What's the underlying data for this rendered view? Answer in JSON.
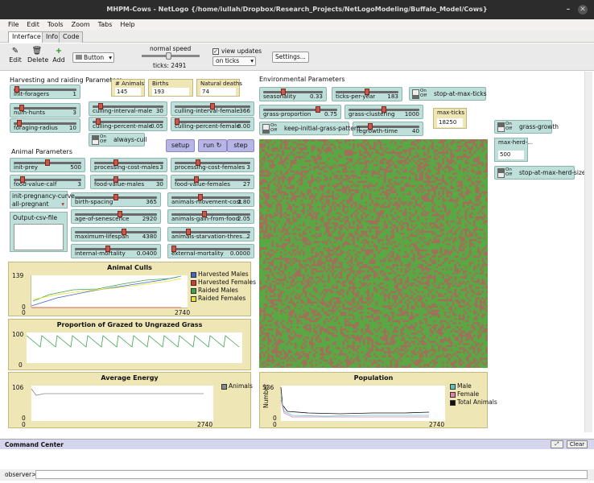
{
  "window": {
    "title": "MHPM-Cows - NetLogo {/home/iullah/Dropbox/Research_Projects/NetLogoModeling/Buffalo_Model/Cows}",
    "minimize": "–",
    "close": "✕"
  },
  "menu": [
    "File",
    "Edit",
    "Tools",
    "Zoom",
    "Tabs",
    "Help"
  ],
  "tabs": [
    "Interface",
    "Info",
    "Code"
  ],
  "toolbar": {
    "edit": "Edit",
    "delete": "Delete",
    "add": "Add",
    "widget_type": "Button",
    "speed_label": "normal speed",
    "ticks_label": "ticks: 2491",
    "view_updates": "view updates",
    "update_mode": "on ticks",
    "settings": "Settings..."
  },
  "headers": {
    "harvest": "Harvesting and raiding Parameters",
    "animal": "Animal Parameters",
    "env": "Environmental Parameters"
  },
  "monitors": {
    "animals_label": "# Animals",
    "animals": "145",
    "births_label": "Births",
    "births": "193",
    "natdeaths_label": "Natural deaths",
    "natdeaths": "74",
    "maxticks_label": "max-ticks",
    "maxticks": "18250",
    "maxherd_label": "max-herd-...",
    "maxherd": "500"
  },
  "sliders": {
    "init_foragers": {
      "label": "init-foragers",
      "value": "1",
      "level": 0.02
    },
    "num_hunts": {
      "label": "num-hunts",
      "value": "3",
      "level": 0.1
    },
    "foraging_radius": {
      "label": "foraging-radius",
      "value": "10",
      "level": 0.05
    },
    "culling_interval_male": {
      "label": "culling-interval-male",
      "value": "30",
      "level": 0.08
    },
    "culling_interval_female": {
      "label": "culling-interval-female",
      "value": "366",
      "level": 0.5
    },
    "culling_percent_male": {
      "label": "culling-percent-male",
      "value": "0.05",
      "level": 0.05
    },
    "culling_percent_female": {
      "label": "culling-percent-female",
      "value": "0.00",
      "level": 0.0
    },
    "init_prey": {
      "label": "init-prey",
      "value": "500",
      "level": 0.5
    },
    "processing_cost_males": {
      "label": "processing-cost-males",
      "value": "3",
      "level": 0.3
    },
    "processing_cost_females": {
      "label": "processing-cost-females",
      "value": "3",
      "level": 0.3
    },
    "food_value_calf": {
      "label": "food-value-calf",
      "value": "3",
      "level": 0.1
    },
    "food_value_males": {
      "label": "food-value-males",
      "value": "30",
      "level": 0.3
    },
    "food_value_females": {
      "label": "food-value-females",
      "value": "27",
      "level": 0.27
    },
    "birth_spacing": {
      "label": "birth-spacing",
      "value": "365",
      "level": 0.5
    },
    "animals_movement_cost": {
      "label": "animals-movement-cost",
      "value": "1.80",
      "level": 0.36
    },
    "age_of_senescence": {
      "label": "age-of-senescence",
      "value": "2920",
      "level": 0.55
    },
    "animals_gain_from_food": {
      "label": "animals-gain-from-food",
      "value": "2.05",
      "level": 0.41
    },
    "maximum_lifespan": {
      "label": "maximum-lifespan",
      "value": "4380",
      "level": 0.6
    },
    "animals_starvation_thres": {
      "label": "animals-starvation-thres...",
      "value": "2",
      "level": 0.2
    },
    "internal_mortality": {
      "label": "internal-mortality",
      "value": "0.0400",
      "level": 0.4
    },
    "external_mortality": {
      "label": "external-mortality",
      "value": "0.0000",
      "level": 0.0
    },
    "seasonality": {
      "label": "seasonality",
      "value": "0.33",
      "level": 0.33
    },
    "ticks_per_year": {
      "label": "ticks-per-year",
      "value": "183",
      "level": 0.5
    },
    "grass_proportion": {
      "label": "grass-proportion",
      "value": "0.75",
      "level": 0.75
    },
    "grass_clustering": {
      "label": "grass-clustering",
      "value": "1000",
      "level": 0.5
    },
    "regrowth_time": {
      "label": "regrowth-time",
      "value": "40",
      "level": 0.2
    }
  },
  "switches": {
    "always_cull": "always-cull",
    "stop_at_max_ticks": "stop-at-max-ticks",
    "keep_initial_grass": "keep-initial-grass-pattern",
    "grass_growth": "grass-growth",
    "stop_at_max_herd": "stop-at-max-herd-size",
    "on": "On",
    "off": "Off"
  },
  "buttons": {
    "setup": "setup",
    "run": "run",
    "step": "step"
  },
  "chooser": {
    "label": "init-pregnancy-curve",
    "value": "all-pregnant"
  },
  "input": {
    "label": "Output-csv-file",
    "value": ""
  },
  "plots": {
    "culls": {
      "title": "Animal Culls",
      "ymax": "139",
      "ymin": "0",
      "xmin": "0",
      "xmax": "2740",
      "legend": [
        "Harvested Males",
        "Harvested Females",
        "Raided Males",
        "Raided Females"
      ]
    },
    "grass": {
      "title": "Proportion of Grazed to Ungrazed Grass",
      "ymax": "100",
      "ymin": "0"
    },
    "energy": {
      "title": "Average Energy",
      "ymax": "106",
      "ymin": "0",
      "xmin": "0",
      "xmax": "2740",
      "legend": [
        "Animals"
      ]
    },
    "pop": {
      "title": "Population",
      "ymax": "536",
      "ymin": "0",
      "xmin": "0",
      "xmax": "2740",
      "ylabel": "Number",
      "legend": [
        "Male",
        "Female",
        "Total Animals"
      ]
    }
  },
  "colors": {
    "harvested_males": "#3f67c9",
    "harvested_females": "#d23b34",
    "raided_males": "#3fa34d",
    "raided_females": "#e6e22a",
    "grass": "#59a844",
    "dirt": "#a0705a",
    "male": "#59c3c3",
    "female": "#e07fb0",
    "total": "#111111"
  },
  "command": {
    "header": "Command Center",
    "clear": "Clear",
    "observer": "observer>"
  }
}
